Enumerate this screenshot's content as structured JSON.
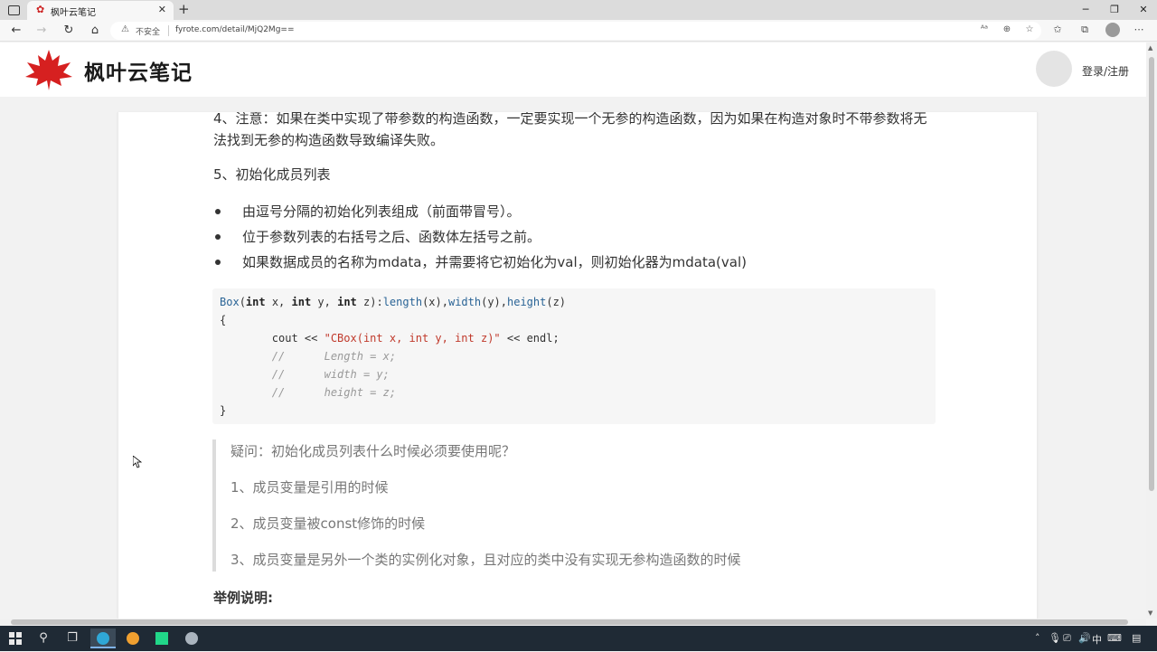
{
  "browser": {
    "tab_title": "枫叶云笔记",
    "tab_close": "✕",
    "new_tab": "+",
    "security_label": "不安全",
    "url": "fyrote.com/detail/MjQ2Mg==",
    "window_controls": {
      "minimize": "─",
      "maximize": "❐",
      "close": "✕"
    },
    "nav_icons": [
      "back-icon",
      "forward-icon",
      "reload-icon",
      "home-icon"
    ],
    "toolbar_icons": [
      "read-aloud-icon",
      "zoom-icon",
      "favorite-add-icon",
      "favorites-icon",
      "collections-icon",
      "profile-icon",
      "more-icon"
    ]
  },
  "site": {
    "logo_text": "枫叶云笔记",
    "login_label": "登录/注册",
    "brand_color": "#d62020"
  },
  "article": {
    "note4": "4、注意：如果在类中实现了带参数的构造函数，一定要实现一个无参的构造函数，因为如果在构造对象时不带参数将无法找到无参的构造函数导致编译失败。",
    "section5_title": "5、初始化成员列表",
    "bullets": [
      "由逗号分隔的初始化列表组成（前面带冒号）。",
      "位于参数列表的右括号之后、函数体左括号之前。",
      "如果数据成员的名称为mdata，并需要将它初始化为val，则初始化器为mdata(val)"
    ],
    "code": {
      "line1_name": "Box",
      "line1_open": "(",
      "line1_int1": "int",
      "line1_x": " x, ",
      "line1_int2": "int",
      "line1_y": " y, ",
      "line1_int3": "int",
      "line1_z": " z):",
      "line1_length": "length",
      "line1_lx": "(x),",
      "line1_width": "width",
      "line1_wy": "(y),",
      "line1_height": "height",
      "line1_hz": "(z)",
      "line2": "{",
      "line3_cout": "        cout << ",
      "line3_str": "\"CBox(int x, int y, int z)\"",
      "line3_end": " << endl;",
      "line4": "        //      Length = x;",
      "line5": "        //      width = y;",
      "line6": "        //      height = z;",
      "line7": "}"
    },
    "quote": [
      "疑问：初始化成员列表什么时候必须要使用呢？",
      "1、成员变量是引用的时候",
      "2、成员变量被const修饰的时候",
      "3、成员变量是另外一个类的实例化对象，且对应的类中没有实现无参构造函数的时候"
    ],
    "example_title": "举例说明:"
  },
  "taskbar": {
    "tray_ime": "中",
    "apps": [
      "windows-start-icon",
      "search-icon",
      "task-view-icon",
      "edge-icon",
      "app-orange-icon",
      "jetbrains-icon",
      "app-gray-icon"
    ]
  }
}
